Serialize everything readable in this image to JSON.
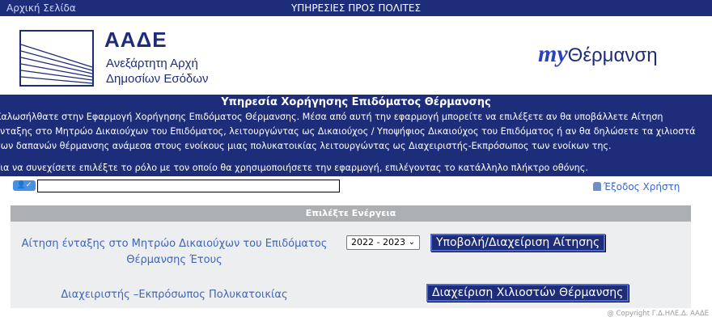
{
  "topbar": {
    "home_link": "Αρχική Σελίδα",
    "title": "ΥΠΗΡΕΣΙΕΣ ΠΡΟΣ ΠΟΛΙΤΕΣ"
  },
  "header": {
    "org_abbr": "ΑΑΔΕ",
    "org_line1": "Ανεξάρτητη Αρχή",
    "org_line2": "Δημοσίων Εσόδων",
    "brand_my": "my",
    "brand_name": "Θέρμανση"
  },
  "intro": {
    "service_title": "Υπηρεσία Χορήγησης Επιδόματος Θέρμανσης",
    "line1": "Καλωσήλθατε στην Εφαρμογή Χορήγησης Επιδόματος Θέρμανσης. Μέσα από αυτή την εφαρμογή μπορείτε να επιλέξετε αν θα υποβάλλετε Αίτηση",
    "line2": "ένταξης στο Μητρώο Δικαιούχων του Επιδόματος, λειτουργώντας ως Δικαιούχος / Υποψήφιος Δικαιούχος του Επιδόματος ή αν θα δηλώσετε τα χιλιοστά",
    "line3": "των δαπανών θέρμανσης ανάμεσα στους ενοίκους μιας πολυκατοικίας λειτουργώντας ως Διαχειριστής-Εκπρόσωπος των ενοίκων της.",
    "instruction": "Για να συνεχίσετε επιλέξτε το ρόλο με τον οποίο θα χρησιμοποιήσετε την εφαρμογή, επιλέγοντας το κατάλληλο πλήκτρο οθόνης."
  },
  "user": {
    "badge": "👤✓",
    "username": "",
    "logout_label": "Έξοδος Χρήστη"
  },
  "panel": {
    "heading": "Επιλέξτε Ενέργεια",
    "row1_label_line1": "Αίτηση ένταξης στο Μητρώο Δικαιούχων του Επιδόματος",
    "row1_label_line2": "Θέρμανσης Έτους",
    "year_value": "2022 - 2023",
    "row1_button": "Υποβολή/Διαχείριση Αίτησης",
    "row2_label": "Διαχειριστής –Εκπρόσωπος Πολυκατοικίας",
    "row2_button": "Διαχείριση Χιλιοστών Θέρμανσης"
  },
  "footer": {
    "copyright": "@ Copyright Γ.Δ.ΗΛΕ.Δ. ΑΑΔΕ"
  },
  "colors": {
    "navy": "#1e2d7a",
    "link_blue": "#3f66b8",
    "panel_bg": "#eceeef",
    "panel_head": "#adb0b3"
  }
}
